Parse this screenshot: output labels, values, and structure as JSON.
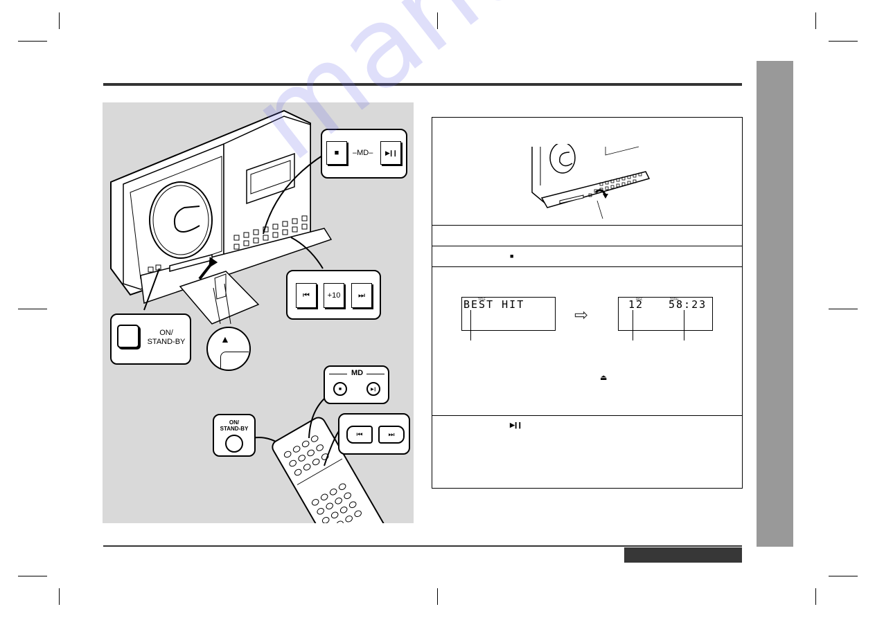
{
  "page": {
    "side_tab_color": "#999999",
    "footer_bar_color": "#373737",
    "illustration_bg": "#d9d9d9"
  },
  "main_unit_callouts": {
    "md_label": "–MD–",
    "stop_icon": "■",
    "play_pause_icon": "▶❙❙",
    "skip_back_icon": "⏮",
    "plus10_label": "+10",
    "skip_forward_icon": "⏭",
    "power_label_line1": "ON/",
    "power_label_line2": "STAND-BY",
    "eject_arrow_icon": "▲"
  },
  "remote_callouts": {
    "md_label": "MD",
    "stop_icon": "■",
    "play_pause_icon": "▶❙",
    "power_label_line1": "ON/",
    "power_label_line2": "STAND-BY",
    "skip_back_icon": "⏮",
    "skip_forward_icon": "⏭"
  },
  "steps": {
    "step2_stop_icon": "■",
    "display_disc_title": "BEST HIT",
    "display_tiny_label_1": "TITLE",
    "display_arrow_icon": "⇨",
    "display_total_tracks": "12",
    "display_tiny_label_2": "DISC",
    "display_total_time": "58:23",
    "display_tiny_label_3": "TOTAL",
    "step3_eject_icon": "⏏",
    "step4_play_pause_icon": "▶❙❙"
  },
  "watermark": "manualshive.com"
}
